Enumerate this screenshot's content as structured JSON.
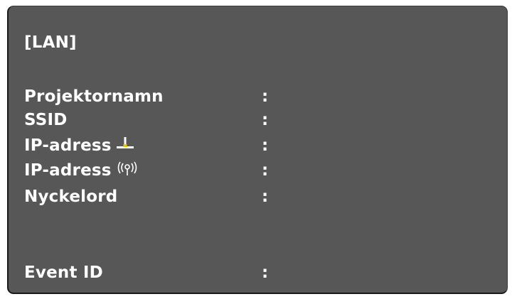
{
  "screen": {
    "title": "[LAN]",
    "separator": ":",
    "fields": [
      {
        "label": "Projektornamn",
        "value": ""
      },
      {
        "label": "SSID",
        "value": ""
      },
      {
        "label": "IP-adress",
        "icon": "wired-lan-icon",
        "value": ""
      },
      {
        "label": "IP-adress",
        "icon": "wireless-lan-icon",
        "value": ""
      },
      {
        "label": "Nyckelord",
        "value": ""
      },
      {
        "label": "Event ID",
        "value": ""
      }
    ]
  },
  "colors": {
    "panel_background": "#575757",
    "text": "#ffffff",
    "wired_icon_accent": "#f0c000"
  }
}
